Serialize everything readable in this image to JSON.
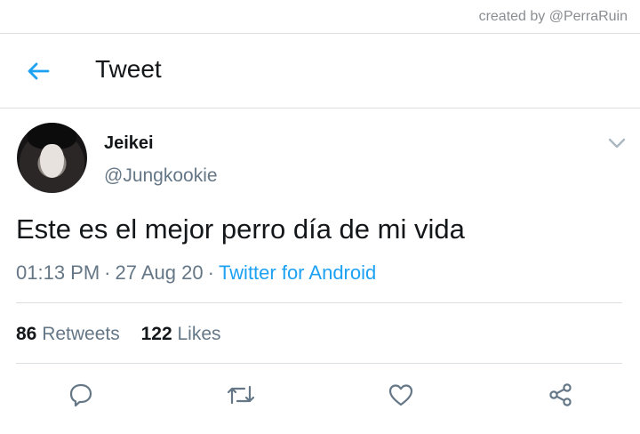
{
  "watermark": {
    "credit": "created by @PerraRuin"
  },
  "header": {
    "title": "Tweet",
    "back_icon": "arrow-left-icon"
  },
  "tweet": {
    "author_name": "Jeikei",
    "author_handle": "@Jungkookie",
    "text": "Este es el mejor perro día de mi vida",
    "time": "01:13 PM",
    "date": "27 Aug 20",
    "separator": "·",
    "source": "Twitter for Android",
    "retweets_count": "86",
    "retweets_label": "Retweets",
    "likes_count": "122",
    "likes_label": "Likes"
  },
  "actions": [
    {
      "icon": "reply-icon"
    },
    {
      "icon": "retweet-icon"
    },
    {
      "icon": "heart-icon"
    },
    {
      "icon": "share-icon"
    }
  ],
  "colors": {
    "accent": "#1da1f2",
    "secondary_text": "#657786",
    "divider": "#dcdfe2",
    "icon": "#657786"
  }
}
